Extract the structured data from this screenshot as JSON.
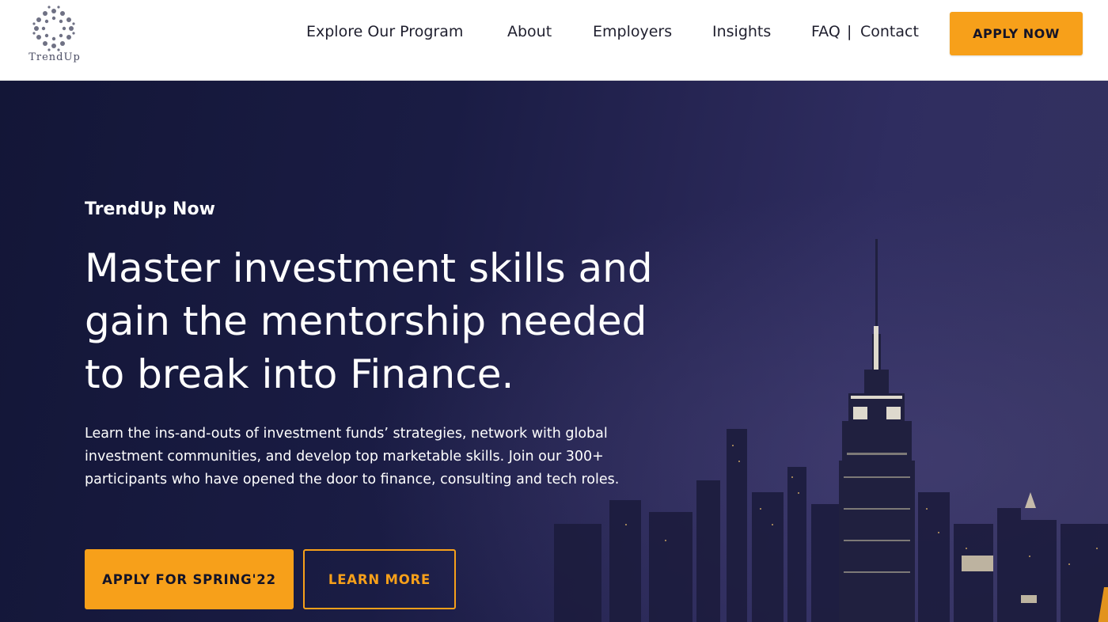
{
  "brand": {
    "name": "TrendUp",
    "logo_icon": "trendup-logo-icon"
  },
  "nav": {
    "items": [
      {
        "label": "Explore Our Program"
      },
      {
        "label": "About"
      },
      {
        "label": "Employers"
      },
      {
        "label": "Insights"
      },
      {
        "label": "FAQ"
      },
      {
        "label": "Contact"
      }
    ],
    "separator": "|",
    "cta_label": "APPLY NOW"
  },
  "hero": {
    "eyebrow": "TrendUp Now",
    "headline": "Master investment skills and gain the mentorship needed to break into Finance.",
    "description": "Learn the ins-and-outs of investment funds’ strategies, network with global investment communities, and develop top marketable skills. Join our 300+ participants who have opened the door to finance, consulting and tech roles.",
    "primary_button": "APPLY FOR SPRING'22",
    "secondary_button": "LEARN MORE",
    "background": "night-city-skyline-image"
  },
  "colors": {
    "accent": "#f7a01a",
    "hero_bg": "#1a1c44",
    "nav_text": "#1f1f2e"
  }
}
